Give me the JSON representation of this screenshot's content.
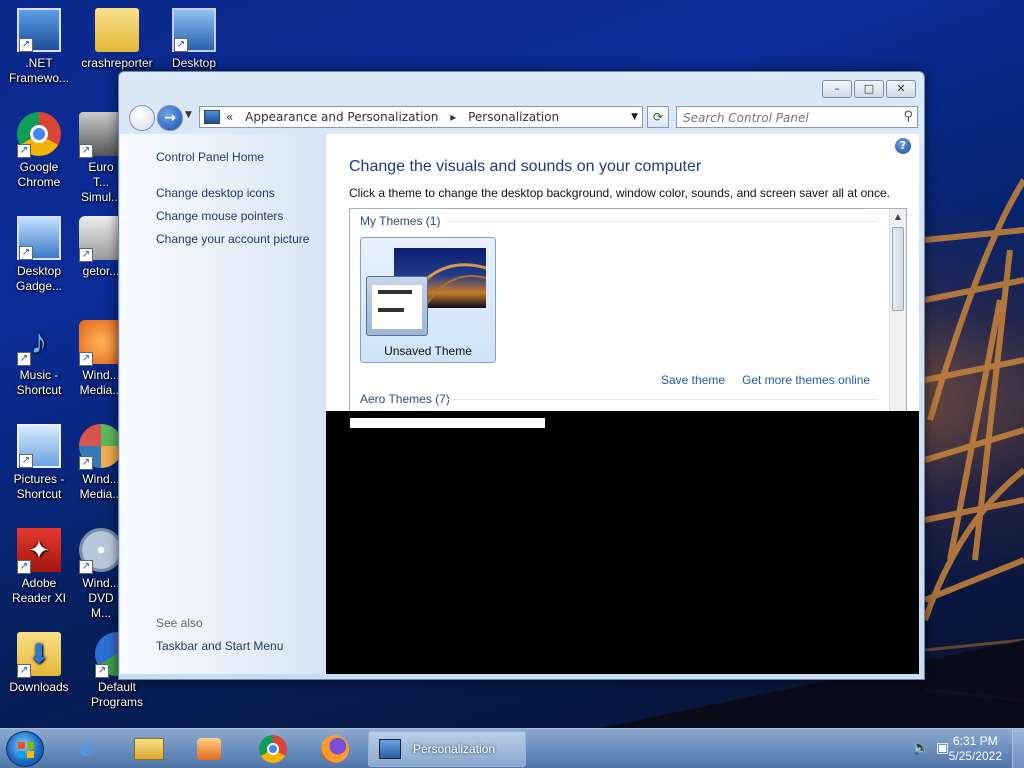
{
  "desktop": {
    "icons": [
      {
        "label": ".NET Framewo...",
        "icon": "dotnet-icon"
      },
      {
        "label": "crashreporter",
        "icon": "folder-icon"
      },
      {
        "label": "Desktop",
        "icon": "desktop-icon"
      },
      {
        "label": "Google Chrome",
        "icon": "chrome-icon"
      },
      {
        "label": "Euro T... Simul...",
        "icon": "game-icon"
      },
      {
        "label": "Desktop Gadge...",
        "icon": "gadgets-icon"
      },
      {
        "label": "getor...",
        "icon": "shortcut-icon"
      },
      {
        "label": "Music - Shortcut",
        "icon": "music-icon"
      },
      {
        "label": "Wind... Media...",
        "icon": "media-player-icon"
      },
      {
        "label": "Pictures - Shortcut",
        "icon": "pictures-icon"
      },
      {
        "label": "Wind... Media...",
        "icon": "media-center-icon"
      },
      {
        "label": "Adobe Reader XI",
        "icon": "adobe-reader-icon"
      },
      {
        "label": "Wind... DVD M...",
        "icon": "dvd-maker-icon"
      },
      {
        "label": "Downloads",
        "icon": "downloads-icon"
      },
      {
        "label": "Default Programs",
        "icon": "default-programs-icon"
      }
    ]
  },
  "window": {
    "buttons": {
      "minimize": "–",
      "maximize": "□",
      "close": "✕"
    },
    "address": {
      "prefix": "«",
      "crumb1": "Appearance and Personalization",
      "sep": "▸",
      "crumb2": "Personalization"
    },
    "search_placeholder": "Search Control Panel",
    "sidebar": {
      "home": "Control Panel Home",
      "links": [
        "Change desktop icons",
        "Change mouse pointers",
        "Change your account picture"
      ],
      "see_also": "See also",
      "see_also_links": [
        "Taskbar and Start Menu"
      ]
    },
    "content": {
      "title": "Change the visuals and sounds on your computer",
      "subtitle": "Click a theme to change the desktop background, window color, sounds, and screen saver all at once.",
      "my_themes": "My Themes (1)",
      "theme_name": "Unsaved Theme",
      "save_theme": "Save theme",
      "get_more": "Get more themes online",
      "aero_themes": "Aero Themes (7)",
      "help": "?"
    }
  },
  "taskbar": {
    "task_label": "Personalization",
    "pinned": [
      "internet-explorer-icon",
      "file-explorer-icon",
      "media-player-icon",
      "chrome-icon",
      "firefox-icon"
    ],
    "time": "6:31 PM",
    "date": "5/25/2022"
  },
  "colors": {
    "accent": "#1e3a8a",
    "link": "#1e5bb3"
  }
}
